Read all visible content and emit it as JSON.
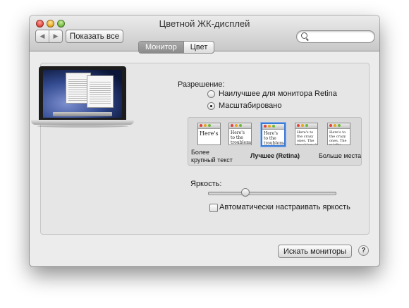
{
  "window": {
    "title": "Цветной ЖК-дисплей"
  },
  "toolbar": {
    "back_glyph": "◀",
    "forward_glyph": "▶",
    "show_all_label": "Показать все",
    "search_placeholder": ""
  },
  "tabs": [
    {
      "label": "Монитор",
      "active": true
    },
    {
      "label": "Цвет",
      "active": false
    }
  ],
  "resolution": {
    "label": "Разрешение:",
    "options": [
      {
        "label": "Наилучшее для монитора Retina",
        "selected": false
      },
      {
        "label": "Масштабировано",
        "selected": true
      }
    ]
  },
  "scaling": {
    "thumbnails": [
      {
        "text": "Here's",
        "selected": false
      },
      {
        "text": "Here's to the troublemak",
        "selected": false
      },
      {
        "text": "Here's to the troublemakers.",
        "selected": true
      },
      {
        "text": "Here's to the crazy ones. The troublemakers. Here's to the misfits.",
        "selected": false
      },
      {
        "text": "Here's to the crazy ones. The misfits. The rebels. The round pegs in the square holes. The ones who see things differently.",
        "selected": false
      }
    ],
    "label_left_line1": "Более",
    "label_left_line2": "крупный текст",
    "label_center": "Лучшее (Retina)",
    "label_right": "Больше места"
  },
  "brightness": {
    "label": "Яркость:",
    "value_fraction": 0.28,
    "auto_label": "Автоматически настраивать яркость",
    "auto_checked": false
  },
  "footer": {
    "detect_label": "Искать мониторы",
    "help_label": "?"
  },
  "colors": {
    "accent": "#3a7bd5",
    "close": "#e0443a",
    "minimize": "#e7a51f",
    "maximize": "#70b83b"
  }
}
